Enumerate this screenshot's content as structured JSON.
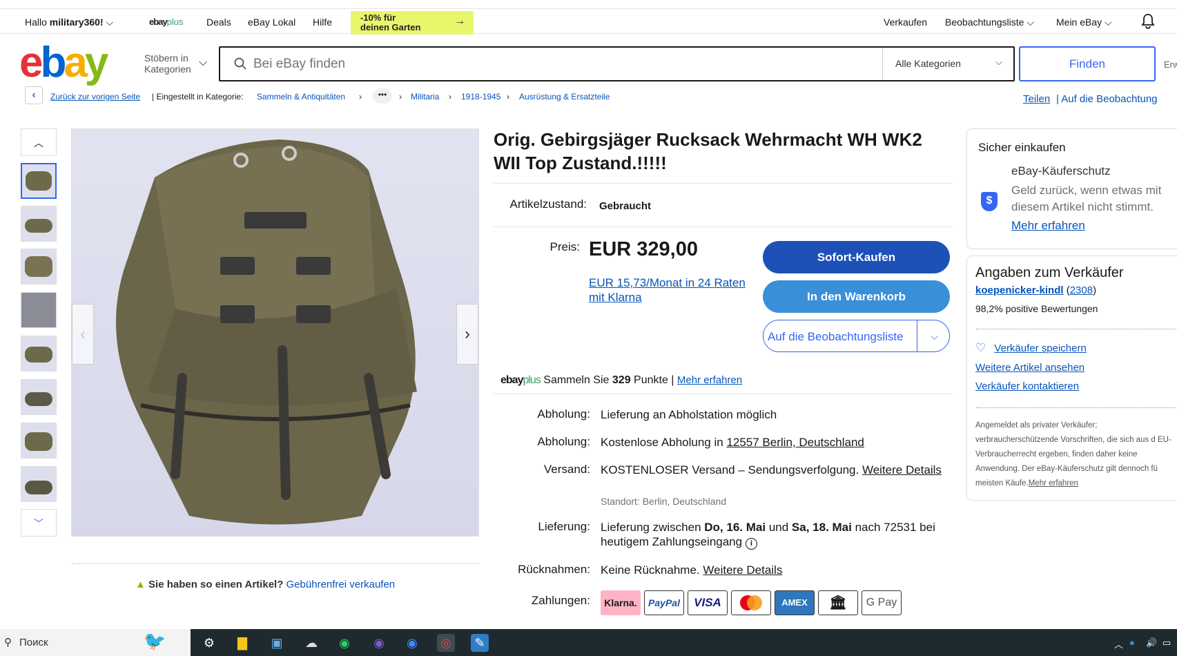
{
  "topnav": {
    "greeting": "Hallo",
    "username": "military360!",
    "ebayplus": "ebay",
    "ebayplus_suffix": "plus",
    "deals": "Deals",
    "lokal": "eBay Lokal",
    "hilfe": "Hilfe",
    "promo_line1": "-10% für",
    "promo_line2": "deinen Garten",
    "verkaufen": "Verkaufen",
    "watchlist": "Beobachtungsliste",
    "myebay": "Mein eBay"
  },
  "header": {
    "browse_line1": "Stöbern in",
    "browse_line2": "Kategorien",
    "search_placeholder": "Bei eBay finden",
    "category": "Alle Kategorien",
    "find": "Finden",
    "advanced": "Erw"
  },
  "breadcrumb": {
    "back": "Zurück zur vorigen Seite",
    "listed_in": "| Eingestellt in Kategorie:",
    "items": [
      "Sammeln & Antiquitäten",
      "Militaria",
      "1918-1945",
      "Ausrüstung & Ersatzteile"
    ],
    "share": "Teilen",
    "watch": "|  Auf die Beobachtung"
  },
  "listing": {
    "title": "Orig. Gebirgsjäger Rucksack Wehrmacht WH WK2 WII Top Zustand.!!!!!",
    "condition_label": "Artikelzustand:",
    "condition": "Gebraucht",
    "price_label": "Preis:",
    "price": "EUR 329,00",
    "klarna": "EUR 15,73/Monat in 24 Raten mit Klarna",
    "buy_now": "Sofort-Kaufen",
    "add_cart": "In den Warenkorb",
    "add_watch": "Auf die Beobachtungsliste",
    "plus_text1": "Sammeln Sie",
    "plus_points": "329",
    "plus_text2": "Punkte |",
    "plus_more": "Mehr erfahren",
    "sell_note": "Sie haben so einen Artikel?",
    "sell_link": "Gebührenfrei verkaufen"
  },
  "shipping": {
    "pickup_label": "Abholung:",
    "pickup1": "Lieferung an Abholstation möglich",
    "pickup2_prefix": "Kostenlose Abholung in",
    "pickup2_link": "12557 Berlin, Deutschland",
    "ship_label": "Versand:",
    "ship_text": "KOSTENLOSER Versand – Sendungsverfolgung.",
    "ship_link": "Weitere Details",
    "location": "Standort: Berlin, Deutschland",
    "delivery_label": "Lieferung:",
    "delivery_p1": "Lieferung zwischen",
    "delivery_d1": "Do, 16. Mai",
    "delivery_und": "und",
    "delivery_d2": "Sa, 18. Mai",
    "delivery_p2": "nach 72531 bei heutigem Zahlungseingang",
    "returns_label": "Rücknahmen:",
    "returns": "Keine Rücknahme.",
    "returns_link": "Weitere Details",
    "payments_label": "Zahlungen:",
    "payments": [
      "Klarna.",
      "PayPal",
      "VISA",
      "",
      "AMEX",
      "",
      "G Pay"
    ]
  },
  "safe": {
    "title": "Sicher einkaufen",
    "protection": "eBay-Käuferschutz",
    "desc": "Geld zurück, wenn etwas mit diesem Artikel nicht stimmt.",
    "more": "Mehr erfahren"
  },
  "seller": {
    "title": "Angaben zum Verkäufer",
    "name": "koepenicker-kindl",
    "score_open": "(",
    "score": "2308",
    "score_close": ")",
    "positive": "98,2% positive Bewertungen",
    "save": "Verkäufer speichern",
    "more_items": "Weitere Artikel ansehen",
    "contact": "Verkäufer kontaktieren",
    "note": "Angemeldet als privater Verkäufer; verbraucherschützende Vorschriften, die sich aus d EU-Verbraucherrecht ergeben, finden daher keine Anwendung. Der eBay-Käuferschutz gilt dennoch fü meisten Käufe.",
    "note_link": "Mehr erfahren"
  },
  "taskbar": {
    "search": "Поиск"
  },
  "colors": {
    "brand_blue": "#3665f3",
    "buy_button": "#1d51b8",
    "cart_button": "#3a8fd9",
    "promo": "#e9f56b"
  }
}
